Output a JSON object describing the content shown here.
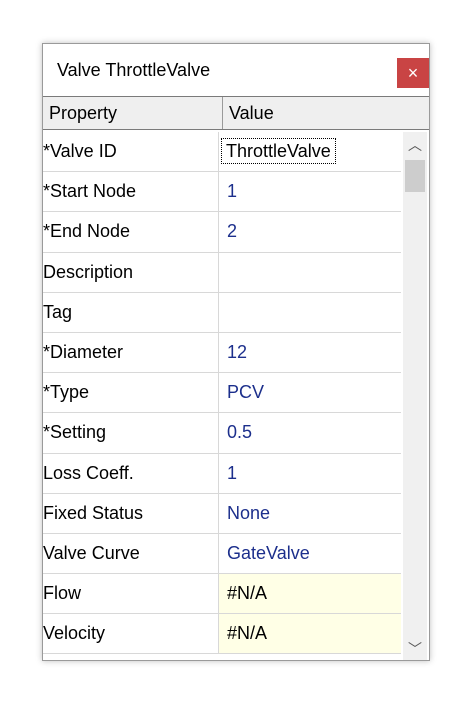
{
  "window": {
    "title": "Valve ThrottleValve",
    "close_glyph": "×"
  },
  "header": {
    "property": "Property",
    "value": "Value"
  },
  "rows": [
    {
      "property": "*Valve ID",
      "value": "ThrottleValve"
    },
    {
      "property": "*Start Node",
      "value": "1"
    },
    {
      "property": "*End Node",
      "value": "2"
    },
    {
      "property": "Description",
      "value": ""
    },
    {
      "property": "Tag",
      "value": ""
    },
    {
      "property": "*Diameter",
      "value": "12"
    },
    {
      "property": "*Type",
      "value": "PCV"
    },
    {
      "property": "*Setting",
      "value": "0.5"
    },
    {
      "property": "Loss Coeff.",
      "value": "1"
    },
    {
      "property": "Fixed Status",
      "value": "None"
    },
    {
      "property": "Valve Curve",
      "value": "GateValve"
    },
    {
      "property": "Flow",
      "value": "#N/A"
    },
    {
      "property": "Velocity",
      "value": "#N/A"
    }
  ],
  "scrollbar": {
    "up_glyph": "︿",
    "down_glyph": "﹀"
  },
  "colors": {
    "close_button": "#c94444",
    "value_text": "#1c2f8c",
    "readonly_bg": "#ffffe6"
  }
}
